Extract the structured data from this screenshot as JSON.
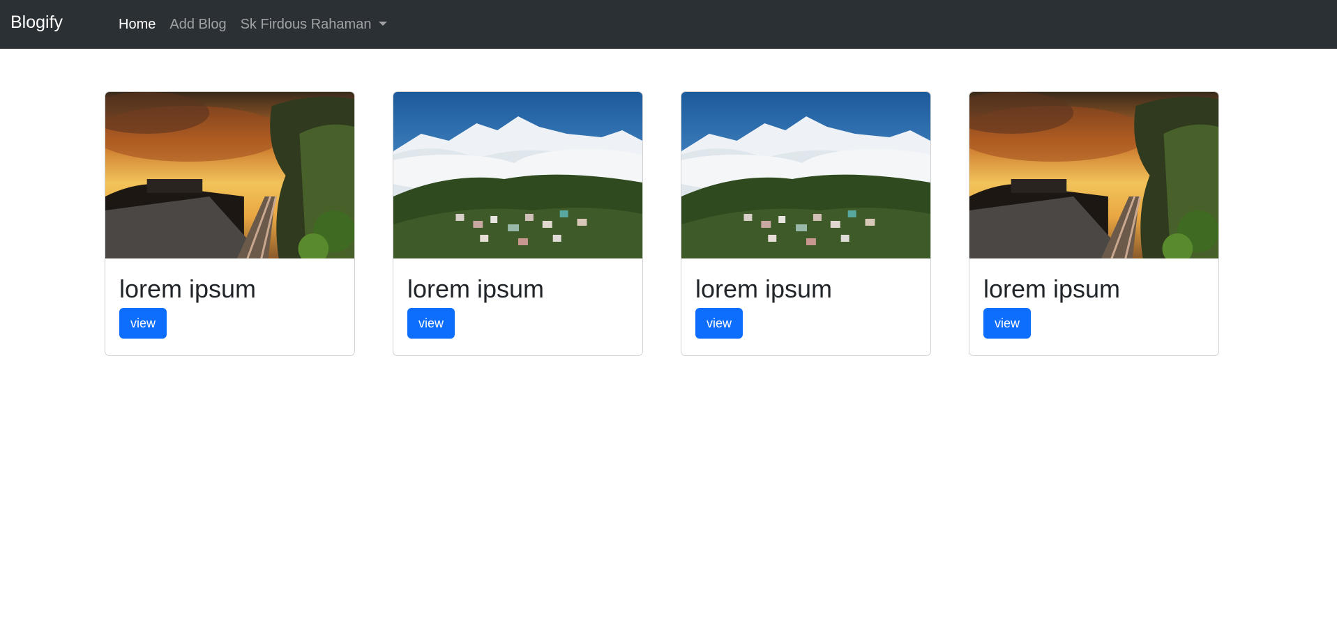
{
  "navbar": {
    "brand": "Blogify",
    "links": [
      {
        "label": "Home",
        "active": true
      },
      {
        "label": "Add Blog",
        "active": false
      },
      {
        "label": "Sk Firdous Rahaman",
        "active": false,
        "dropdown": true
      }
    ]
  },
  "cards": [
    {
      "title": "lorem ipsum",
      "button": "view",
      "image": "railway-sunset"
    },
    {
      "title": "lorem ipsum",
      "button": "view",
      "image": "mountain-town"
    },
    {
      "title": "lorem ipsum",
      "button": "view",
      "image": "mountain-town"
    },
    {
      "title": "lorem ipsum",
      "button": "view",
      "image": "railway-sunset"
    }
  ],
  "colors": {
    "navbar_bg": "#2b3035",
    "primary": "#0d6efd"
  }
}
